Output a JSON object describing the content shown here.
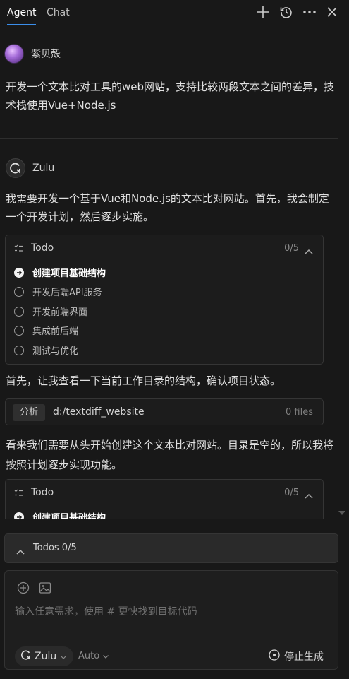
{
  "header": {
    "tabs": [
      {
        "label": "Agent"
      },
      {
        "label": "Chat"
      }
    ]
  },
  "conversation": {
    "user": {
      "name": "紫贝殻",
      "message": "开发一个文本比对工具的web网站，支持比较两段文本之间的差异，技术栈使用Vue+Node.js"
    },
    "bot": {
      "name": "Zulu",
      "message1": "我需要开发一个基于Vue和Node.js的文本比对网站。首先，我会制定一个开发计划，然后逐步实施。",
      "todo1": {
        "title": "Todo",
        "count": "0/5",
        "items": [
          {
            "label": "创建项目基础结构"
          },
          {
            "label": "开发后端API服务"
          },
          {
            "label": "开发前端界面"
          },
          {
            "label": "集成前后端"
          },
          {
            "label": "测试与优化"
          }
        ]
      },
      "message2": "首先，让我查看一下当前工作目录的结构，确认项目状态。",
      "analyze": {
        "tag": "分析",
        "path": "d:/textdiff_website",
        "count": "0 files"
      },
      "message3": "看来我们需要从头开始创建这个文本比对网站。目录是空的，所以我将按照计划逐步实现功能。",
      "todo2": {
        "title": "Todo",
        "count": "0/5",
        "items": [
          {
            "label": "创建项目基础结构"
          }
        ]
      }
    }
  },
  "todos_bar": {
    "label": "Todos 0/5"
  },
  "input": {
    "placeholder": "输入任意需求，使用 # 更快找到目标代码",
    "value": ""
  },
  "footer": {
    "model": "Zulu",
    "mode": "Auto",
    "stop_label": "停止生成"
  },
  "colors": {
    "background": "#181818",
    "accent": "#3b8eea",
    "panel": "#1c1c1c",
    "border": "#353535"
  }
}
